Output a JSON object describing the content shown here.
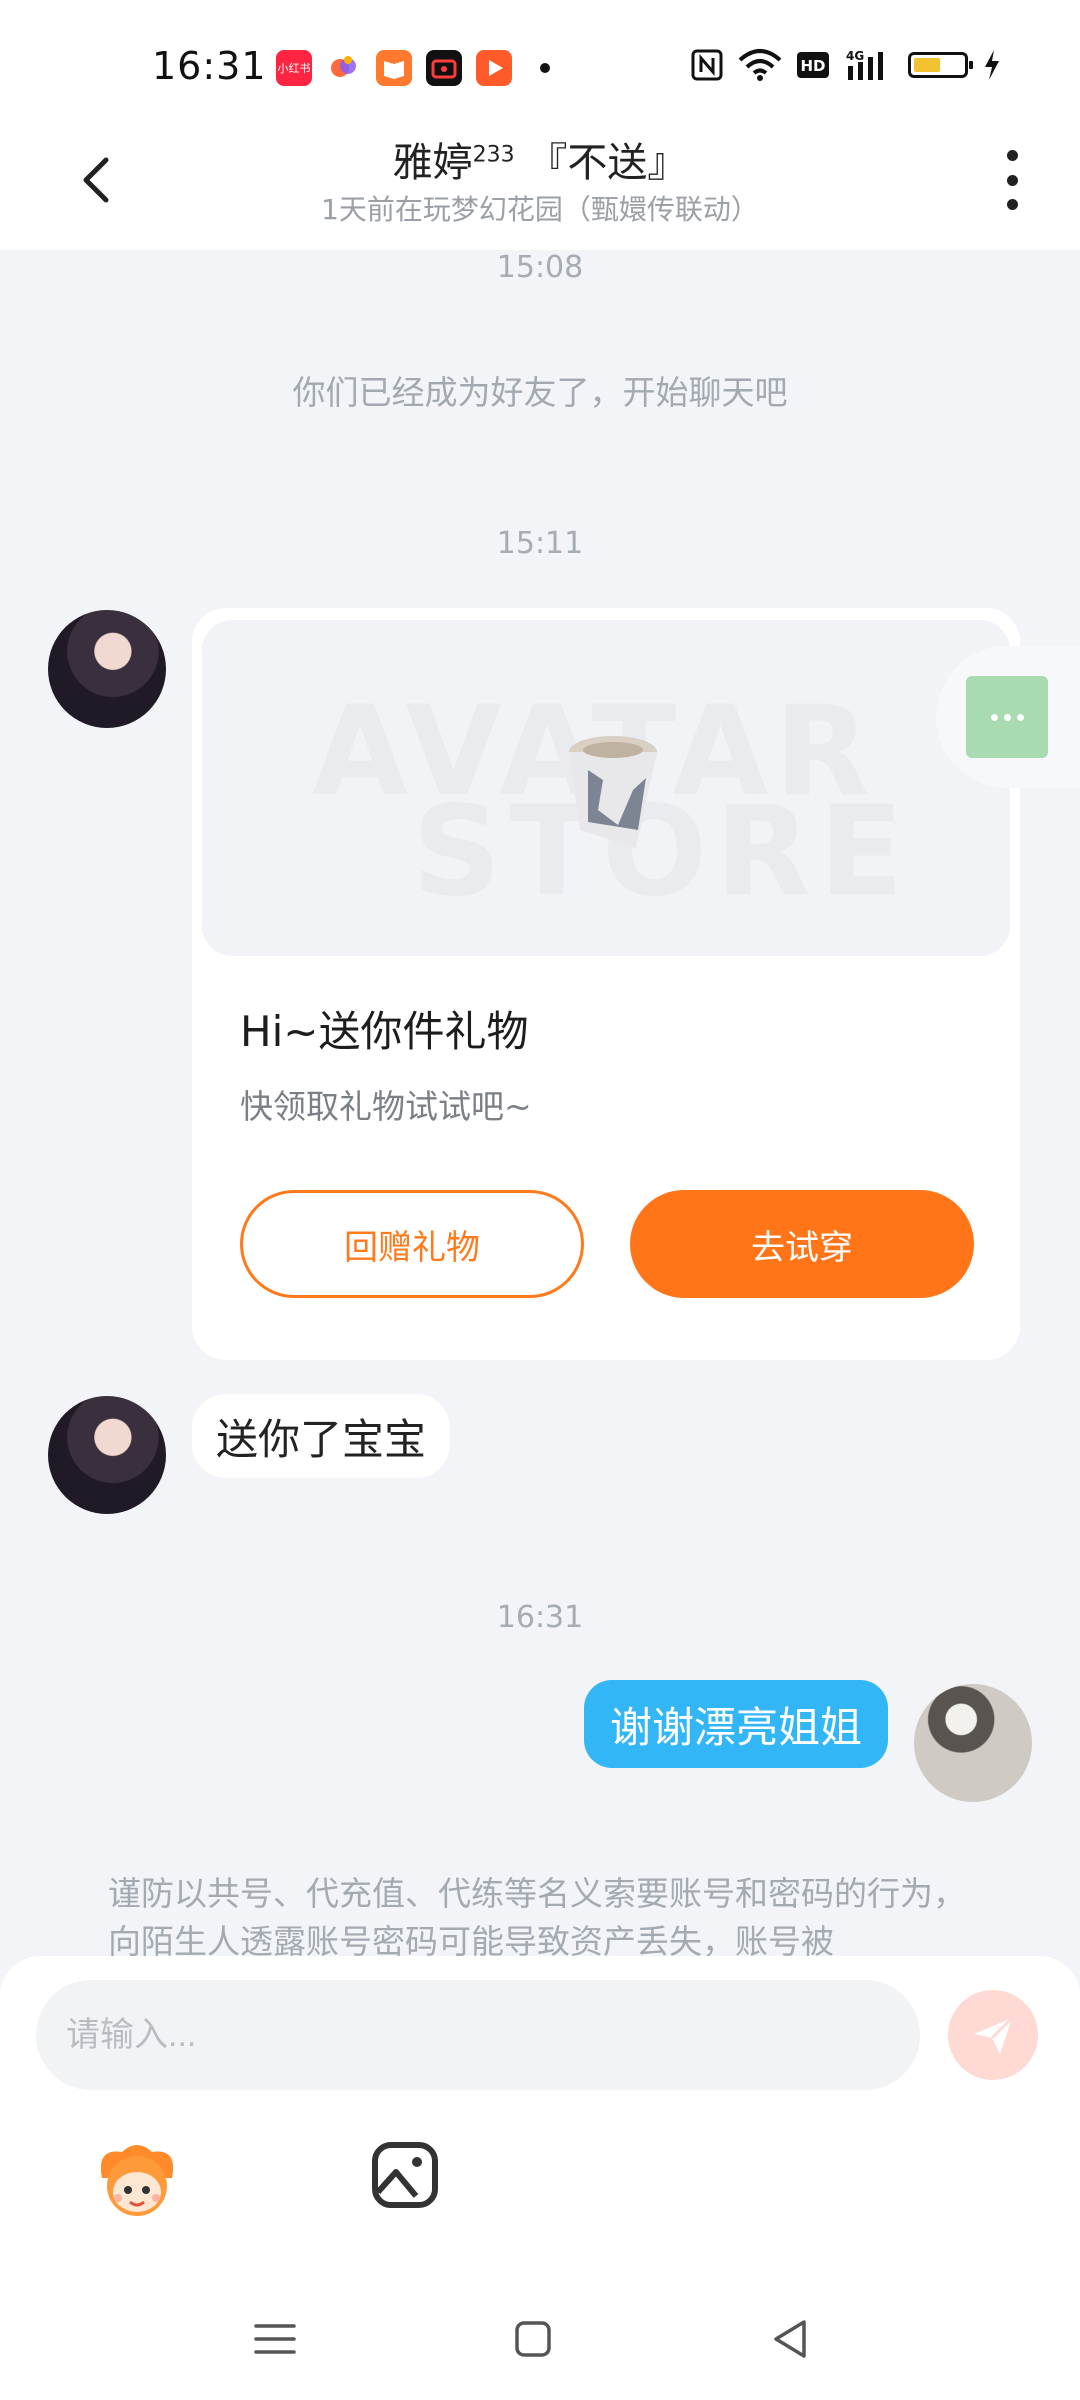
{
  "status_bar": {
    "time": "16:31",
    "app_icons": [
      "xiaohongshu-icon",
      "assistant-icon",
      "reader-icon",
      "video-recorder-icon",
      "video-play-icon"
    ],
    "notification_dot": "•",
    "system_icons": [
      "nfc-icon",
      "wifi-icon",
      "hd-icon",
      "4g-signal-icon",
      "battery-icon",
      "charging-icon"
    ],
    "battery_level": 0.45
  },
  "header": {
    "title": "雅婷",
    "title_sup": "233",
    "title_suffix": " 『不送』",
    "subtitle": "1天前在玩梦幻花园（甄嬛传联动）"
  },
  "chat": {
    "timestamp_1": "15:08",
    "system_message": "你们已经成为好友了，开始聊天吧",
    "timestamp_2": "15:11",
    "gift_card": {
      "watermark_line1": "AVATAR",
      "watermark_line2": "STORE",
      "title": "Hi~送你件礼物",
      "description": "快领取礼物试试吧~",
      "return_gift_label": "回赠礼物",
      "try_on_label": "去试穿"
    },
    "message_from_friend": "送你了宝宝",
    "timestamp_3": "16:31",
    "message_from_me": "谢谢漂亮姐姐",
    "warning": "谨防以共号、代充值、代练等名义索要账号和密码的行为，向陌生人透露账号密码可能导致资产丢失，账号被"
  },
  "composer": {
    "placeholder": "请输入..."
  },
  "colors": {
    "accent_orange": "#ff7518",
    "my_bubble": "#33b6f5",
    "background": "#f2f4f8"
  }
}
